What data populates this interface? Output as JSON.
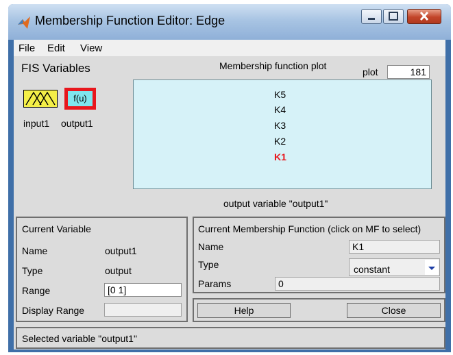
{
  "window": {
    "title": "Membership Function Editor: Edge",
    "controls": [
      "minimize-icon",
      "maximize-icon",
      "close-icon"
    ]
  },
  "menu": [
    "File",
    "Edit",
    "View"
  ],
  "fis": {
    "heading": "FIS Variables",
    "input_label": "input1",
    "output_label": "output1",
    "output_icon_text": "f(u)"
  },
  "plot": {
    "title": "Membership function plot",
    "points_label": "plot",
    "points_value": "181",
    "mfs": [
      "K5",
      "K4",
      "K3",
      "K2",
      "K1"
    ],
    "selected_mf": "K1",
    "caption": "output variable \"output1\""
  },
  "current_variable": {
    "heading": "Current Variable",
    "name_label": "Name",
    "name_value": "output1",
    "type_label": "Type",
    "type_value": "output",
    "range_label": "Range",
    "range_value": "[0 1]",
    "display_range_label": "Display Range",
    "display_range_value": ""
  },
  "current_mf": {
    "heading": "Current Membership Function (click on MF to select)",
    "name_label": "Name",
    "name_value": "K1",
    "type_label": "Type",
    "type_value": "constant",
    "params_label": "Params",
    "params_value": "0"
  },
  "buttons": {
    "help": "Help",
    "close": "Close"
  },
  "status": "Selected variable \"output1\"",
  "colors": {
    "selected_mf": "#e8171d",
    "plot_bg": "#d6f2f8",
    "input_icon": "#f4ef48",
    "output_icon": "#7fe6ef",
    "selected_border": "#e8171d"
  }
}
